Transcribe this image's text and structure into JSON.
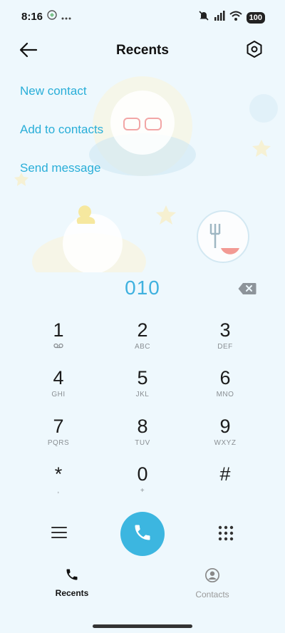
{
  "status_bar": {
    "time": "8:16",
    "battery": "100",
    "icons": [
      "app-notification-icon",
      "more-dots-icon",
      "mute-icon",
      "signal-icon",
      "wifi-icon",
      "battery-icon"
    ]
  },
  "header": {
    "title": "Recents",
    "back_icon": "back-arrow-icon",
    "settings_icon": "settings-icon"
  },
  "actions": {
    "new_contact": "New contact",
    "add_to_contacts": "Add to contacts",
    "send_message": "Send message"
  },
  "dialer": {
    "number": "010",
    "delete_icon": "backspace-icon"
  },
  "keypad": {
    "keys": [
      {
        "digit": "1",
        "letters": ""
      },
      {
        "digit": "2",
        "letters": "ABC"
      },
      {
        "digit": "3",
        "letters": "DEF"
      },
      {
        "digit": "4",
        "letters": "GHI"
      },
      {
        "digit": "5",
        "letters": "JKL"
      },
      {
        "digit": "6",
        "letters": "MNO"
      },
      {
        "digit": "7",
        "letters": "PQRS"
      },
      {
        "digit": "8",
        "letters": "TUV"
      },
      {
        "digit": "9",
        "letters": "WXYZ"
      },
      {
        "digit": "*",
        "letters": ","
      },
      {
        "digit": "0",
        "letters": "+"
      },
      {
        "digit": "#",
        "letters": ""
      }
    ]
  },
  "bottom_row": {
    "menu_icon": "menu-icon",
    "call_icon": "phone-icon",
    "keypad_icon": "keypad-icon"
  },
  "bottom_nav": {
    "recents": "Recents",
    "contacts": "Contacts"
  },
  "colors": {
    "accent": "#3cb6e0",
    "link": "#29aed8",
    "background": "#eef8fd"
  }
}
